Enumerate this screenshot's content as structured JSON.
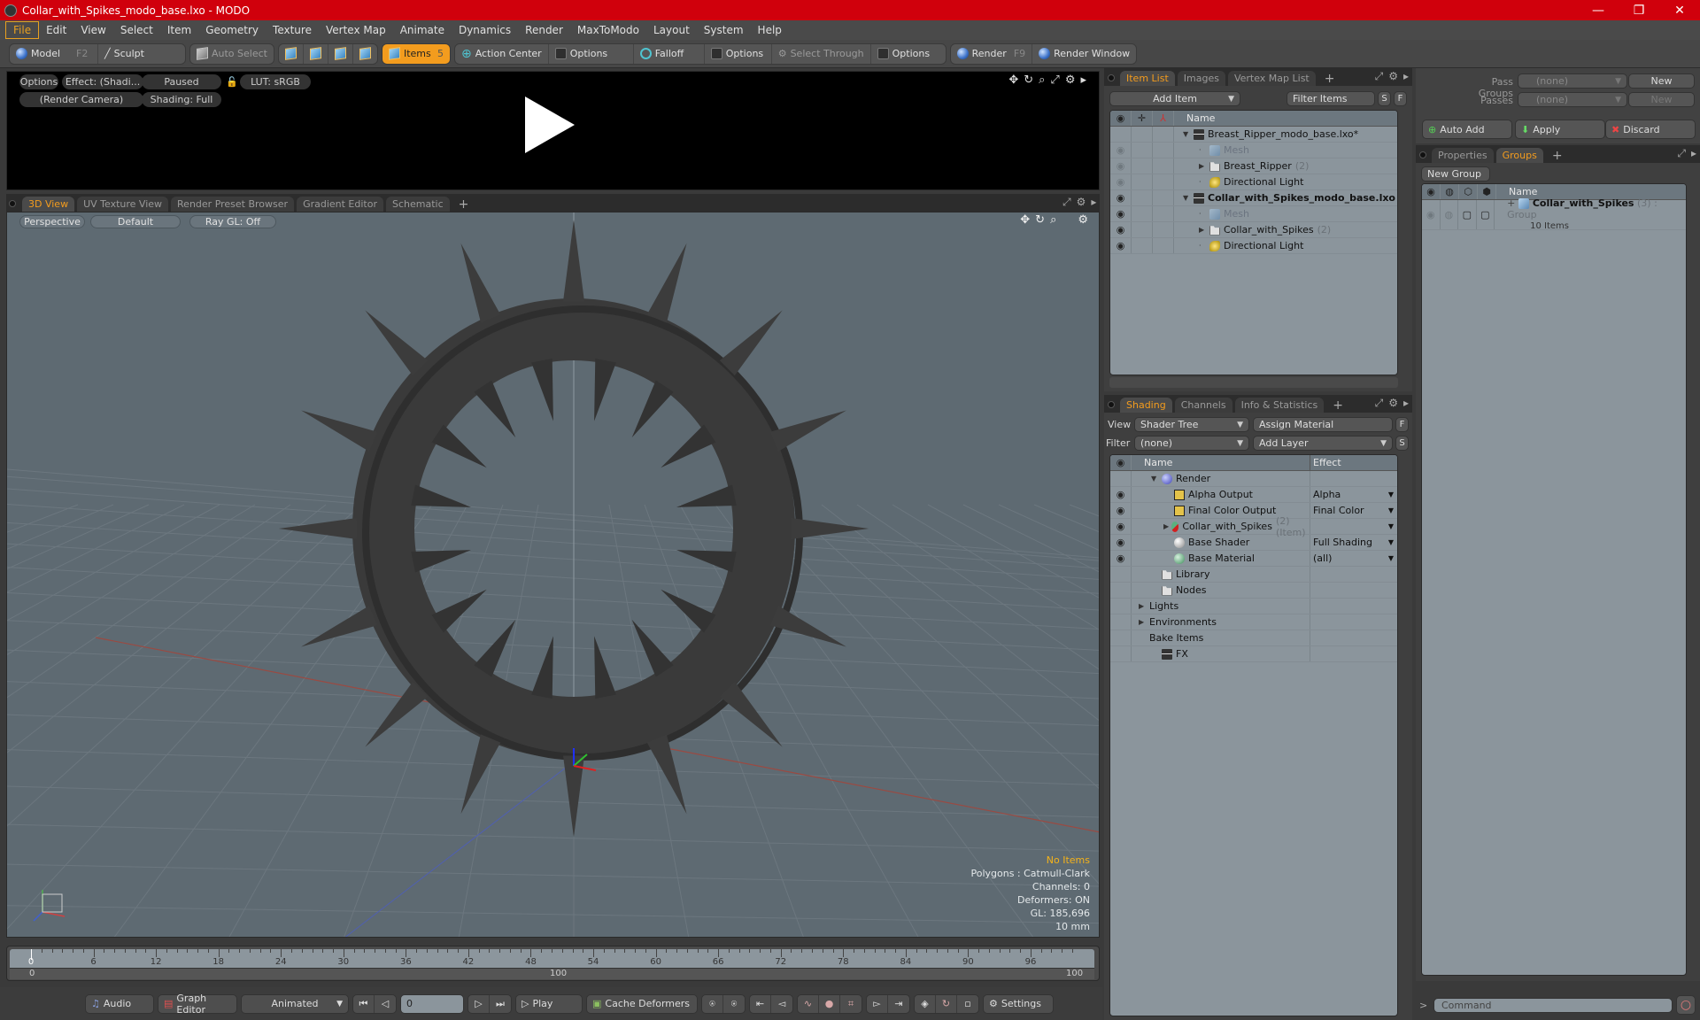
{
  "window": {
    "title": "Collar_with_Spikes_modo_base.lxo - MODO",
    "controls": {
      "minimize": "—",
      "restore": "❐",
      "close": "✕"
    }
  },
  "menu": [
    "File",
    "Edit",
    "View",
    "Select",
    "Item",
    "Geometry",
    "Texture",
    "Vertex Map",
    "Animate",
    "Dynamics",
    "Render",
    "MaxToModo",
    "Layout",
    "System",
    "Help"
  ],
  "toolbar": {
    "model": "Model",
    "model_key": "F2",
    "sculpt": "Sculpt",
    "auto_select": "Auto Select",
    "items": "Items",
    "items_key": "5",
    "action_center": "Action Center",
    "options1": "Options",
    "falloff": "Falloff",
    "options2": "Options",
    "select_through": "Select Through",
    "options3": "Options",
    "render": "Render",
    "render_key": "F9",
    "render_window": "Render Window"
  },
  "preview": {
    "options": "Options",
    "effect": "Effect: (Shadi...",
    "paused": "Paused",
    "lut": "LUT: sRGB",
    "camera": "(Render Camera)",
    "shading": "Shading: Full"
  },
  "viewport_tabs": [
    {
      "label": "3D View",
      "active": true
    },
    {
      "label": "UV Texture View",
      "active": false
    },
    {
      "label": "Render Preset Browser",
      "active": false
    },
    {
      "label": "Gradient Editor",
      "active": false
    },
    {
      "label": "Schematic",
      "active": false
    }
  ],
  "viewport": {
    "projection": "Perspective",
    "style": "Default",
    "raygl": "Ray GL: Off",
    "stats": {
      "selection": "No Items",
      "polygons": "Polygons : Catmull-Clark",
      "channels": "Channels: 0",
      "deformers": "Deformers: ON",
      "gl": "GL: 185,696",
      "scale": "10 mm"
    }
  },
  "timeline": {
    "ticks": [
      "0",
      "6",
      "12",
      "18",
      "24",
      "30",
      "36",
      "42",
      "48",
      "54",
      "60",
      "66",
      "72",
      "78",
      "84",
      "90",
      "96"
    ],
    "range_start": "0",
    "range_mid": "100",
    "range_end": "100",
    "current_frame": "0"
  },
  "bottombar": {
    "audio": "Audio",
    "graph_editor": "Graph Editor",
    "animated": "Animated",
    "frame": "0",
    "play": "Play",
    "cache_deformers": "Cache Deformers",
    "settings": "Settings"
  },
  "item_list": {
    "tabs": [
      {
        "label": "Item List",
        "active": true
      },
      {
        "label": "Images",
        "active": false
      },
      {
        "label": "Vertex Map List",
        "active": false
      }
    ],
    "add_item": "Add Item",
    "filter": "Filter Items",
    "s": "S",
    "f": "F",
    "header_name": "Name",
    "rows": [
      {
        "name": "Breast_Ripper_modo_base.lxo*",
        "count": "",
        "icon": "clap",
        "indent": 0,
        "expand": "▼",
        "eye": "",
        "bold": false
      },
      {
        "name": "Mesh",
        "count": "",
        "icon": "mesh",
        "indent": 1,
        "expand": "",
        "eye": "off",
        "bold": false,
        "dim": true
      },
      {
        "name": "Breast_Ripper",
        "count": "(2)",
        "icon": "folder",
        "indent": 1,
        "expand": "▶",
        "eye": "off",
        "bold": false
      },
      {
        "name": "Directional Light",
        "count": "",
        "icon": "light",
        "indent": 1,
        "expand": "",
        "eye": "off",
        "bold": false
      },
      {
        "name": "Collar_with_Spikes_modo_base.lxo",
        "count": "",
        "icon": "clap",
        "indent": 0,
        "expand": "▼",
        "eye": "on",
        "bold": true
      },
      {
        "name": "Mesh",
        "count": "",
        "icon": "mesh",
        "indent": 1,
        "expand": "",
        "eye": "on",
        "bold": false,
        "dim": true
      },
      {
        "name": "Collar_with_Spikes",
        "count": "(2)",
        "icon": "folder",
        "indent": 1,
        "expand": "▶",
        "eye": "on",
        "bold": false
      },
      {
        "name": "Directional Light",
        "count": "",
        "icon": "light",
        "indent": 1,
        "expand": "",
        "eye": "on",
        "bold": false
      }
    ]
  },
  "shading": {
    "tabs": [
      {
        "label": "Shading",
        "active": true
      },
      {
        "label": "Channels",
        "active": false
      },
      {
        "label": "Info & Statistics",
        "active": false
      }
    ],
    "view_label": "View",
    "view_value": "Shader Tree",
    "assign_material": "Assign Material",
    "filter_label": "Filter",
    "filter_value": "(none)",
    "add_layer": "Add Layer",
    "f": "F",
    "s": "S",
    "header_name": "Name",
    "header_effect": "Effect",
    "rows": [
      {
        "name": "Render",
        "extra": "",
        "effect": "",
        "icon": "sph-blue",
        "indent": 0,
        "expand": "▼",
        "eye": false,
        "dropdown": false
      },
      {
        "name": "Alpha Output",
        "extra": "",
        "effect": "Alpha",
        "icon": "img",
        "indent": 1,
        "expand": "",
        "eye": true,
        "dropdown": true
      },
      {
        "name": "Final Color Output",
        "extra": "",
        "effect": "Final Color",
        "icon": "img",
        "indent": 1,
        "expand": "",
        "eye": true,
        "dropdown": true
      },
      {
        "name": "Collar_with_Spikes",
        "extra": "(2) (Item)",
        "effect": "",
        "icon": "sph-mat",
        "indent": 1,
        "expand": "▶",
        "eye": true,
        "dropdown": true
      },
      {
        "name": "Base Shader",
        "extra": "",
        "effect": "Full Shading",
        "icon": "sph-white",
        "indent": 1,
        "expand": "",
        "eye": true,
        "dropdown": true
      },
      {
        "name": "Base Material",
        "extra": "",
        "effect": "(all)",
        "icon": "sph-green",
        "indent": 1,
        "expand": "",
        "eye": true,
        "dropdown": true
      },
      {
        "name": "Library",
        "extra": "",
        "effect": "",
        "icon": "folder",
        "indent": 0,
        "expand": "",
        "eye": false,
        "dropdown": false
      },
      {
        "name": "Nodes",
        "extra": "",
        "effect": "",
        "icon": "folder",
        "indent": 0,
        "expand": "",
        "eye": false,
        "dropdown": false
      },
      {
        "name": "Lights",
        "extra": "",
        "effect": "",
        "icon": "",
        "indent": -1,
        "expand": "▶",
        "eye": false,
        "dropdown": false
      },
      {
        "name": "Environments",
        "extra": "",
        "effect": "",
        "icon": "",
        "indent": -1,
        "expand": "▶",
        "eye": false,
        "dropdown": false
      },
      {
        "name": "Bake Items",
        "extra": "",
        "effect": "",
        "icon": "",
        "indent": -1,
        "expand": "",
        "eye": false,
        "dropdown": false
      },
      {
        "name": "FX",
        "extra": "",
        "effect": "",
        "icon": "clap",
        "indent": 0,
        "expand": "",
        "eye": false,
        "dropdown": false
      }
    ]
  },
  "passes": {
    "pass_groups_label": "Pass Groups",
    "pass_groups_value": "(none)",
    "new1": "New",
    "passes_label": "Passes",
    "passes_value": "(none)",
    "new2": "New",
    "auto_add": "Auto Add",
    "apply": "Apply",
    "discard": "Discard"
  },
  "groups": {
    "tabs": [
      {
        "label": "Properties",
        "active": false
      },
      {
        "label": "Groups",
        "active": true
      }
    ],
    "new_group": "New Group",
    "header_name": "Name",
    "rows": [
      {
        "name": "Collar_with_Spikes",
        "count": "(3)",
        "type": ": Group",
        "sub": "10 Items"
      }
    ]
  },
  "command": {
    "prompt": ">",
    "placeholder": "Command"
  },
  "colors": {
    "titlebar": "#d0000c",
    "accent": "#f39c1e",
    "viewport_bg": "#5e6a72",
    "list_bg": "#8b959c"
  }
}
